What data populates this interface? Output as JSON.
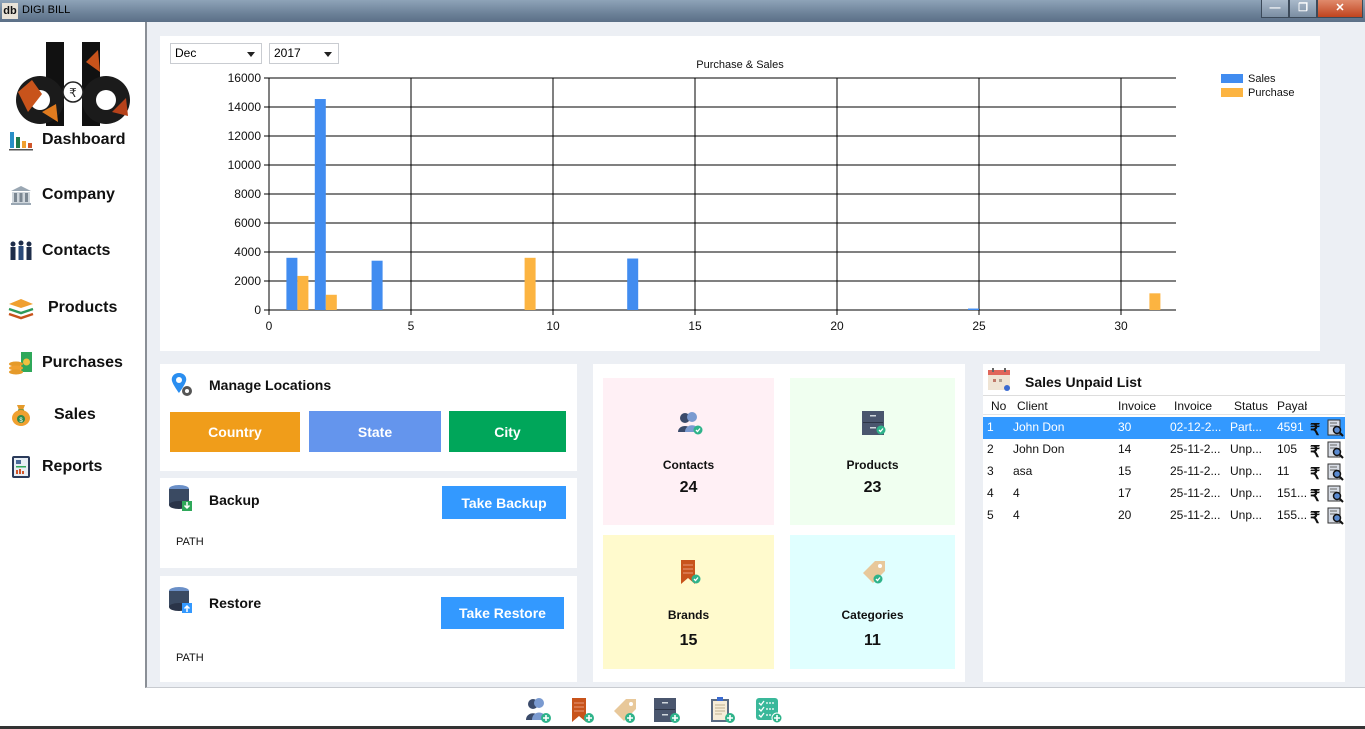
{
  "window": {
    "title": "DIGI BILL",
    "app_icon_text": "db",
    "controls": {
      "minimize": "—",
      "maximize": "❐",
      "close": "✕"
    }
  },
  "sidebar": {
    "logo_text": "db",
    "items": [
      {
        "label": "Dashboard",
        "icon": "bar-chart-icon"
      },
      {
        "label": "Company",
        "icon": "bank-building-icon"
      },
      {
        "label": "Contacts",
        "icon": "people-group-icon"
      },
      {
        "label": "Products",
        "icon": "layers-stack-icon"
      },
      {
        "label": "Purchases",
        "icon": "coins-cash-icon"
      },
      {
        "label": "Sales",
        "icon": "money-bag-icon"
      },
      {
        "label": "Reports",
        "icon": "report-document-icon"
      }
    ]
  },
  "chart_filters": {
    "month": "Dec",
    "year": "2017"
  },
  "chart_data": {
    "type": "bar",
    "title": "Purchase & Sales",
    "xlabel": "",
    "ylabel": "",
    "xlim": [
      0,
      32
    ],
    "ylim": [
      0,
      16000
    ],
    "xticks": [
      0,
      5,
      10,
      15,
      20,
      25,
      30
    ],
    "yticks": [
      0,
      2000,
      4000,
      6000,
      8000,
      10000,
      12000,
      14000,
      16000
    ],
    "grid": true,
    "legend_position": "top-right",
    "series": [
      {
        "name": "Sales",
        "color": "#418cf0",
        "points": [
          {
            "x": 1,
            "y": 3600
          },
          {
            "x": 2,
            "y": 14550
          },
          {
            "x": 4,
            "y": 3400
          },
          {
            "x": 13,
            "y": 3550
          },
          {
            "x": 25,
            "y": 100
          }
        ]
      },
      {
        "name": "Purchase",
        "color": "#fcb441",
        "points": [
          {
            "x": 1,
            "y": 2350
          },
          {
            "x": 2,
            "y": 1050
          },
          {
            "x": 9,
            "y": 3600
          },
          {
            "x": 31,
            "y": 1150
          }
        ]
      }
    ]
  },
  "locations": {
    "title": "Manage Locations",
    "icon": "location-gear-icon",
    "buttons": [
      {
        "label": "Country",
        "color": "#f09d1a"
      },
      {
        "label": "State",
        "color": "#6495ed"
      },
      {
        "label": "City",
        "color": "#00a65a"
      }
    ]
  },
  "backup": {
    "title": "Backup",
    "button": "Take Backup",
    "path_label": "PATH",
    "button_color": "#3399ff"
  },
  "restore": {
    "title": "Restore",
    "button": "Take Restore",
    "path_label": "PATH",
    "button_color": "#3399ff"
  },
  "stats": [
    {
      "label": "Contacts",
      "value": "24",
      "bg": "#fff0f5",
      "icon": "contacts-check-icon"
    },
    {
      "label": "Products",
      "value": "23",
      "bg": "#f0fff0",
      "icon": "cabinet-check-icon"
    },
    {
      "label": "Brands",
      "value": "15",
      "bg": "#fffacd",
      "icon": "bookmark-check-icon"
    },
    {
      "label": "Categories",
      "value": "11",
      "bg": "#e0ffff",
      "icon": "tag-check-icon"
    }
  ],
  "unpaid": {
    "title": "Sales Unpaid List",
    "icon": "calendar-icon",
    "columns": [
      "No",
      "Client",
      "Invoice",
      "Invoice",
      "Status",
      "Payable"
    ],
    "rows": [
      {
        "no": "1",
        "client": "John Don",
        "invoice_no": "30",
        "invoice_date": "02-12-2...",
        "status": "Part...",
        "payable": "4591",
        "selected": true
      },
      {
        "no": "2",
        "client": "John Don",
        "invoice_no": "14",
        "invoice_date": "25-11-2...",
        "status": "Unp...",
        "payable": "105",
        "selected": false
      },
      {
        "no": "3",
        "client": "asa",
        "invoice_no": "15",
        "invoice_date": "25-11-2...",
        "status": "Unp...",
        "payable": "11",
        "selected": false
      },
      {
        "no": "4",
        "client": "4",
        "invoice_no": "17",
        "invoice_date": "25-11-2...",
        "status": "Unp...",
        "payable": "151...",
        "selected": false
      },
      {
        "no": "5",
        "client": "4",
        "invoice_no": "20",
        "invoice_date": "25-11-2...",
        "status": "Unp...",
        "payable": "155...",
        "selected": false
      }
    ],
    "row_actions": {
      "pay_symbol": "₹"
    }
  },
  "quick_add": [
    {
      "icon": "add-contact-icon"
    },
    {
      "icon": "add-brand-icon"
    },
    {
      "icon": "add-category-icon"
    },
    {
      "icon": "add-product-icon"
    },
    {
      "icon": "add-purchase-icon"
    },
    {
      "icon": "add-sale-icon"
    }
  ]
}
